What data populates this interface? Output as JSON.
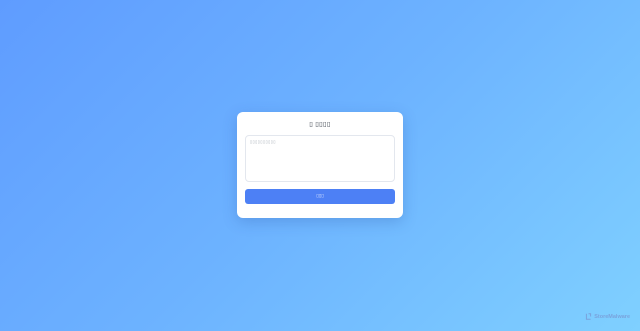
{
  "card": {
    "title_icon": "▯",
    "title": "▯▯▯▯",
    "textarea_placeholder": "▯▯▯▯▯▯▯▯▯▯",
    "submit_label": "▯▯▯"
  },
  "watermark": {
    "text": "StoreMalware",
    "logo_icon": "storemalware-logo-icon"
  },
  "colors": {
    "background_start": "#5f9cff",
    "background_end": "#7fd0ff",
    "card": "#ffffff",
    "accent": "#4d80f5"
  }
}
